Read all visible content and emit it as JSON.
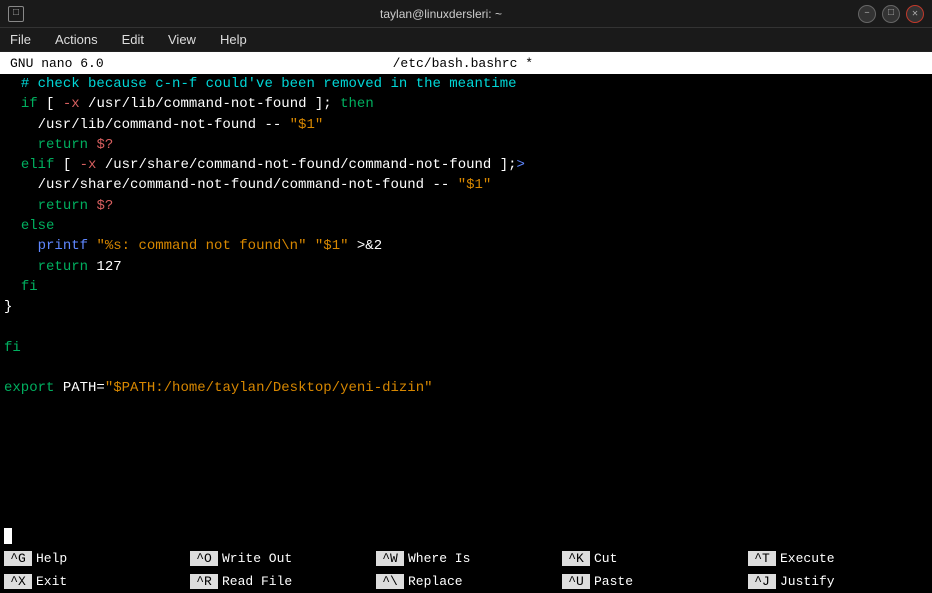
{
  "titlebar": {
    "title": "taylan@linuxdersleri: ~",
    "icon": "□"
  },
  "menubar": {
    "items": [
      "File",
      "Actions",
      "Edit",
      "View",
      "Help"
    ]
  },
  "nano_header": {
    "left": "GNU nano 6.0",
    "center": "/etc/bash.bashrc *"
  },
  "editor": {
    "lines": [
      "  # check because c-n-f could've been removed in the meantime",
      "  if [ -x /usr/lib/command-not-found ]; then",
      "    /usr/lib/command-not-found -- \"$1\"",
      "    return $?",
      "  elif [ -x /usr/share/command-not-found/command-not-found ];>",
      "    /usr/share/command-not-found/command-not-found -- \"$1\"",
      "    return $?",
      "  else",
      "    printf \"%s: command not found\\n\" \"$1\" >&2",
      "    return 127",
      "  fi",
      "}",
      "",
      "fi",
      "",
      "export PATH=\"$PATH:/home/taylan/Desktop/yeni-dizin\""
    ]
  },
  "shortcuts": {
    "row1": [
      {
        "key": "^G",
        "label": "Help"
      },
      {
        "key": "^O",
        "label": "Write Out"
      },
      {
        "key": "^W",
        "label": "Where Is"
      },
      {
        "key": "^K",
        "label": "Cut"
      },
      {
        "key": "^T",
        "label": "Execute"
      }
    ],
    "row2": [
      {
        "key": "^X",
        "label": "Exit"
      },
      {
        "key": "^R",
        "label": "Read File"
      },
      {
        "key": "^\\",
        "label": "Replace"
      },
      {
        "key": "^U",
        "label": "Paste"
      },
      {
        "key": "^J",
        "label": "Justify"
      }
    ]
  }
}
